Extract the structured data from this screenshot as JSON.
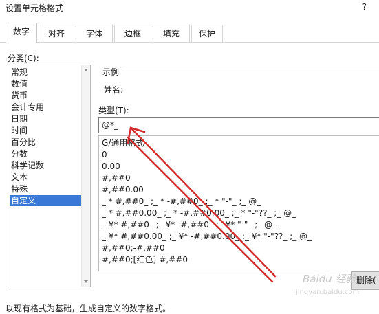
{
  "dialog": {
    "title": "设置单元格格式",
    "help": "?"
  },
  "tabs": [
    "数字",
    "对齐",
    "字体",
    "边框",
    "填充",
    "保护"
  ],
  "category": {
    "label": "分类(C):",
    "items": [
      "常规",
      "数值",
      "货币",
      "会计专用",
      "日期",
      "时间",
      "百分比",
      "分数",
      "科学记数",
      "文本",
      "特殊",
      "自定义"
    ],
    "selected_index": 11
  },
  "sample": {
    "label": "示例",
    "field": "姓名:"
  },
  "type_field": {
    "label": "类型(T):",
    "value": "@*_"
  },
  "format_list": [
    "G/通用格式",
    "0",
    "0.00",
    "#,##0",
    "#,##0.00",
    "_ * #,##0_ ;_ * -#,##0_ ;_ * \"-\"_ ;_ @_",
    "_ * #,##0.00_ ;_ * -#,##0.00_ ;_ * \"-\"??_ ;_ @_",
    "_ ¥* #,##0_ ;_ ¥* -#,##0_ ;_ ¥* \"-\"_ ;_ @_",
    "_ ¥* #,##0.00_ ;_ ¥* -#,##0.00_ ;_ ¥* \"-\"??_ ;_ @_",
    "#,##0;-#,##0",
    "#,##0;[红色]-#,##0"
  ],
  "delete_button": "删除(",
  "bottom_note": "以现有格式为基础，生成自定义的数字格式。",
  "watermark": {
    "text": "Baidu 经验",
    "sub": "jingyan.baidu.com"
  },
  "annotation": {
    "color": "#d42b2b"
  }
}
